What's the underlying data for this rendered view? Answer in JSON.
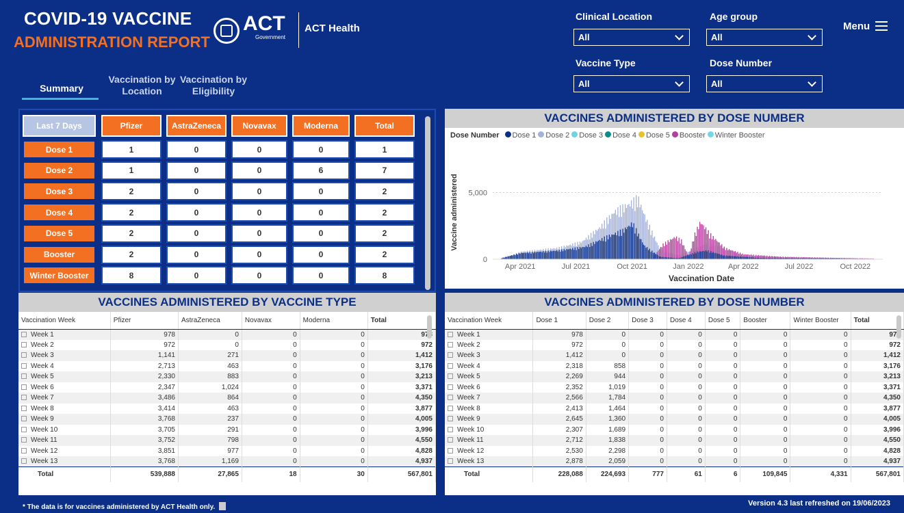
{
  "header": {
    "title_line1": "COVID-19 VACCINE",
    "title_line2": "ADMINISTRATION REPORT",
    "act_logo": "ACT",
    "act_logo_sub": "Government",
    "org": "ACT Health",
    "menu_label": "Menu"
  },
  "tabs": [
    {
      "label": "Summary",
      "active": true
    },
    {
      "label": "Vaccination by Location",
      "active": false
    },
    {
      "label": "Vaccination by Eligibility",
      "active": false
    }
  ],
  "filters": {
    "clinical_location": {
      "label": "Clinical Location",
      "value": "All"
    },
    "age_group": {
      "label": "Age group",
      "value": "All"
    },
    "vaccine_type": {
      "label": "Vaccine Type",
      "value": "All"
    },
    "dose_number": {
      "label": "Dose Number",
      "value": "All"
    }
  },
  "summary": {
    "corner": "Last 7 Days",
    "columns": [
      "Pfizer",
      "AstraZeneca",
      "Novavax",
      "Moderna",
      "Total"
    ],
    "rows": [
      {
        "label": "Dose 1",
        "values": [
          "1",
          "0",
          "0",
          "0",
          "1"
        ]
      },
      {
        "label": "Dose 2",
        "values": [
          "1",
          "0",
          "0",
          "6",
          "7"
        ]
      },
      {
        "label": "Dose 3",
        "values": [
          "2",
          "0",
          "0",
          "0",
          "2"
        ]
      },
      {
        "label": "Dose 4",
        "values": [
          "2",
          "0",
          "0",
          "0",
          "2"
        ]
      },
      {
        "label": "Dose 5",
        "values": [
          "2",
          "0",
          "0",
          "0",
          "2"
        ]
      },
      {
        "label": "Booster",
        "values": [
          "2",
          "0",
          "0",
          "0",
          "2"
        ]
      },
      {
        "label": "Winter Booster",
        "values": [
          "8",
          "0",
          "0",
          "0",
          "8"
        ]
      }
    ]
  },
  "chart_panel": {
    "title": "VACCINES ADMINISTERED BY DOSE NUMBER",
    "legend_title": "Dose Number"
  },
  "chart_data": {
    "type": "bar",
    "stacked": true,
    "xlabel": "Vaccination Date",
    "ylabel": "Vaccine administered",
    "y_ticks": [
      "0",
      "5,000"
    ],
    "x_ticks": [
      "Apr 2021",
      "Jul 2021",
      "Oct 2021",
      "Jan 2022",
      "Apr 2022",
      "Jul 2022",
      "Oct 2022"
    ],
    "ylim": [
      0,
      6000
    ],
    "grid": true,
    "legend": "top",
    "series": [
      {
        "name": "Dose 1",
        "color": "#0b2f86"
      },
      {
        "name": "Dose 2",
        "color": "#a5b1d6"
      },
      {
        "name": "Dose 3",
        "color": "#6fd3e3"
      },
      {
        "name": "Dose 4",
        "color": "#0f8a8a"
      },
      {
        "name": "Dose 5",
        "color": "#e8c22a"
      },
      {
        "name": "Booster",
        "color": "#b23f9b"
      },
      {
        "name": "Winter Booster",
        "color": "#72d8e8"
      }
    ],
    "x_range": [
      "2021-02-15",
      "2022-11-15"
    ],
    "envelopes": [
      {
        "series": "Dose 2",
        "points": [
          [
            "2021-03-01",
            0
          ],
          [
            "2021-04-01",
            600
          ],
          [
            "2021-06-01",
            900
          ],
          [
            "2021-07-10",
            1400
          ],
          [
            "2021-08-10",
            2600
          ],
          [
            "2021-09-01",
            3800
          ],
          [
            "2021-09-25",
            4400
          ],
          [
            "2021-10-10",
            4900
          ],
          [
            "2021-10-25",
            3000
          ],
          [
            "2021-11-15",
            800
          ],
          [
            "2021-12-15",
            300
          ],
          [
            "2022-01-10",
            800
          ],
          [
            "2022-01-31",
            1300
          ],
          [
            "2022-02-28",
            900
          ],
          [
            "2022-03-31",
            300
          ],
          [
            "2022-06-15",
            150
          ],
          [
            "2022-10-31",
            50
          ]
        ]
      },
      {
        "series": "Dose 1",
        "points": [
          [
            "2021-03-01",
            100
          ],
          [
            "2021-04-01",
            500
          ],
          [
            "2021-06-01",
            700
          ],
          [
            "2021-07-15",
            1000
          ],
          [
            "2021-08-20",
            1800
          ],
          [
            "2021-09-15",
            2300
          ],
          [
            "2021-10-01",
            2900
          ],
          [
            "2021-10-20",
            1100
          ],
          [
            "2021-11-15",
            200
          ],
          [
            "2021-12-15",
            80
          ],
          [
            "2022-01-15",
            600
          ],
          [
            "2022-01-31",
            700
          ],
          [
            "2022-02-28",
            300
          ],
          [
            "2022-04-30",
            100
          ],
          [
            "2022-10-31",
            20
          ]
        ]
      },
      {
        "series": "Booster",
        "points": [
          [
            "2021-11-01",
            0
          ],
          [
            "2021-11-20",
            1200
          ],
          [
            "2021-12-10",
            1800
          ],
          [
            "2021-12-20",
            1500
          ],
          [
            "2022-01-01",
            200
          ],
          [
            "2022-01-10",
            1900
          ],
          [
            "2022-01-20",
            3000
          ],
          [
            "2022-02-05",
            2000
          ],
          [
            "2022-03-01",
            900
          ],
          [
            "2022-04-01",
            400
          ],
          [
            "2022-06-01",
            200
          ],
          [
            "2022-10-31",
            50
          ]
        ]
      }
    ]
  },
  "vaccine_table": {
    "title": "VACCINES ADMINISTERED BY VACCINE TYPE",
    "columns": [
      "Vaccination Week",
      "Pfizer",
      "AstraZeneca",
      "Novavax",
      "Moderna",
      "Total"
    ],
    "rows": [
      [
        "Week 1",
        "978",
        "0",
        "0",
        "0",
        "978"
      ],
      [
        "Week 2",
        "972",
        "0",
        "0",
        "0",
        "972"
      ],
      [
        "Week 3",
        "1,141",
        "271",
        "0",
        "0",
        "1,412"
      ],
      [
        "Week 4",
        "2,713",
        "463",
        "0",
        "0",
        "3,176"
      ],
      [
        "Week 5",
        "2,330",
        "883",
        "0",
        "0",
        "3,213"
      ],
      [
        "Week 6",
        "2,347",
        "1,024",
        "0",
        "0",
        "3,371"
      ],
      [
        "Week 7",
        "3,486",
        "864",
        "0",
        "0",
        "4,350"
      ],
      [
        "Week 8",
        "3,414",
        "463",
        "0",
        "0",
        "3,877"
      ],
      [
        "Week 9",
        "3,768",
        "237",
        "0",
        "0",
        "4,005"
      ],
      [
        "Week 10",
        "3,705",
        "291",
        "0",
        "0",
        "3,996"
      ],
      [
        "Week 11",
        "3,752",
        "798",
        "0",
        "0",
        "4,550"
      ],
      [
        "Week 12",
        "3,851",
        "977",
        "0",
        "0",
        "4,828"
      ],
      [
        "Week 13",
        "3,768",
        "1,169",
        "0",
        "0",
        "4,937"
      ]
    ],
    "total": [
      "Total",
      "539,888",
      "27,865",
      "18",
      "30",
      "567,801"
    ]
  },
  "dose_table": {
    "title": "VACCINES ADMINISTERED BY DOSE NUMBER",
    "columns": [
      "Vaccination Week",
      "Dose 1",
      "Dose 2",
      "Dose 3",
      "Dose 4",
      "Dose 5",
      "Booster",
      "Winter Booster",
      "Total"
    ],
    "rows": [
      [
        "Week 1",
        "978",
        "0",
        "0",
        "0",
        "0",
        "0",
        "0",
        "978"
      ],
      [
        "Week 2",
        "972",
        "0",
        "0",
        "0",
        "0",
        "0",
        "0",
        "972"
      ],
      [
        "Week 3",
        "1,412",
        "0",
        "0",
        "0",
        "0",
        "0",
        "0",
        "1,412"
      ],
      [
        "Week 4",
        "2,318",
        "858",
        "0",
        "0",
        "0",
        "0",
        "0",
        "3,176"
      ],
      [
        "Week 5",
        "2,269",
        "944",
        "0",
        "0",
        "0",
        "0",
        "0",
        "3,213"
      ],
      [
        "Week 6",
        "2,352",
        "1,019",
        "0",
        "0",
        "0",
        "0",
        "0",
        "3,371"
      ],
      [
        "Week 7",
        "2,566",
        "1,784",
        "0",
        "0",
        "0",
        "0",
        "0",
        "4,350"
      ],
      [
        "Week 8",
        "2,413",
        "1,464",
        "0",
        "0",
        "0",
        "0",
        "0",
        "3,877"
      ],
      [
        "Week 9",
        "2,645",
        "1,360",
        "0",
        "0",
        "0",
        "0",
        "0",
        "4,005"
      ],
      [
        "Week 10",
        "2,307",
        "1,689",
        "0",
        "0",
        "0",
        "0",
        "0",
        "3,996"
      ],
      [
        "Week 11",
        "2,712",
        "1,838",
        "0",
        "0",
        "0",
        "0",
        "0",
        "4,550"
      ],
      [
        "Week 12",
        "2,530",
        "2,298",
        "0",
        "0",
        "0",
        "0",
        "0",
        "4,828"
      ],
      [
        "Week 13",
        "2,878",
        "2,059",
        "0",
        "0",
        "0",
        "0",
        "0",
        "4,937"
      ]
    ],
    "total": [
      "Total",
      "228,088",
      "224,693",
      "777",
      "61",
      "6",
      "109,845",
      "4,331",
      "567,801"
    ]
  },
  "footer": {
    "note": "* The data is for vaccines administered by ACT Health only.",
    "version": "Version 4.3 last refreshed on 19/06/2023"
  }
}
